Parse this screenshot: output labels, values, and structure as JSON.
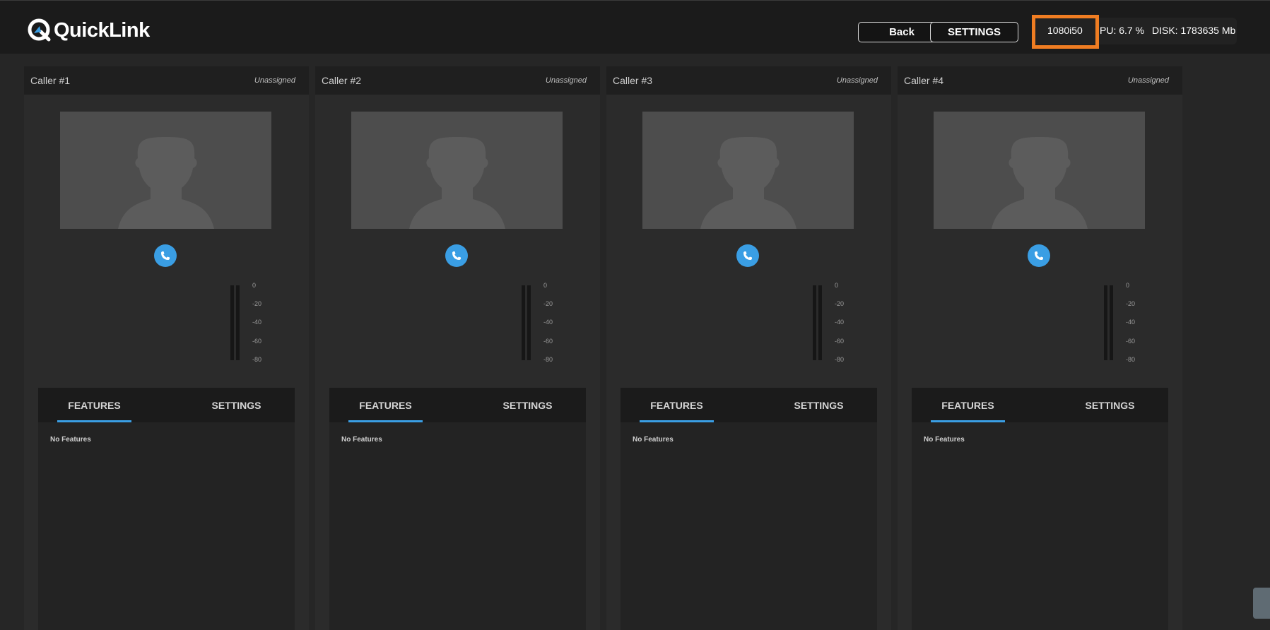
{
  "app": {
    "logo_text": "QuickLink",
    "accent_color": "#3a9ee4",
    "highlight_color": "#f07d22"
  },
  "toolbar": {
    "back_label": "Back",
    "settings_label": "SETTINGS"
  },
  "status": {
    "resolution": "1080i50",
    "cpu": "PU: 6.7 %",
    "disk": "DISK: 1783635 Mb"
  },
  "meter_scale": [
    "0",
    "-20",
    "-40",
    "-60",
    "-80"
  ],
  "callers": [
    {
      "title": "Caller #1",
      "status": "Unassigned",
      "tabs": [
        "FEATURES",
        "SETTINGS"
      ],
      "empty_text": "No Features"
    },
    {
      "title": "Caller #2",
      "status": "Unassigned",
      "tabs": [
        "FEATURES",
        "SETTINGS"
      ],
      "empty_text": "No Features"
    },
    {
      "title": "Caller #3",
      "status": "Unassigned",
      "tabs": [
        "FEATURES",
        "SETTINGS"
      ],
      "empty_text": "No Features"
    },
    {
      "title": "Caller #4",
      "status": "Unassigned",
      "tabs": [
        "FEATURES",
        "SETTINGS"
      ],
      "empty_text": "No Features"
    }
  ]
}
